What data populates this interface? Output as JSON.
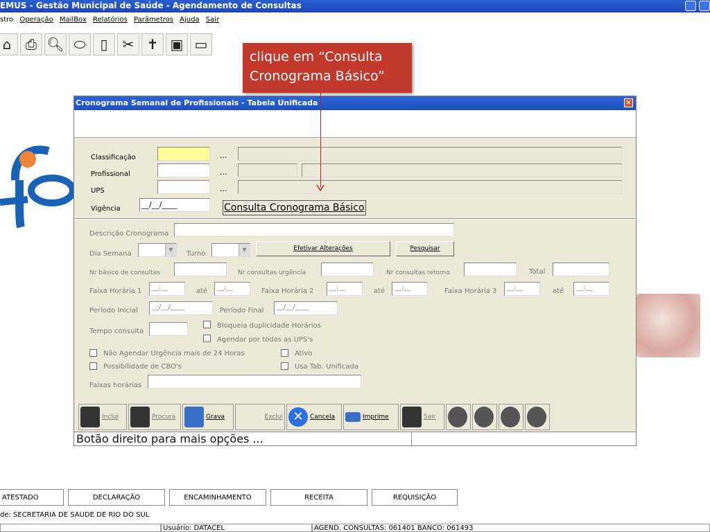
{
  "app_title": "EMUS - Gestão Municipal de Saúde - Agendamento de Consultas",
  "menu": [
    "stro",
    "Operação",
    "MailBox",
    "Relatórios",
    "Parâmetros",
    "Ajuda",
    "Sair"
  ],
  "toolbar_icons": [
    "house-icon",
    "printer-icon",
    "search-doc-icon",
    "pill-icon",
    "clipboard-icon",
    "tools-icon",
    "cross-icon",
    "medical-bag-icon",
    "ambulance-icon"
  ],
  "callout": {
    "text": "clique em “Consulta Cronograma Básico”",
    "color": "#c0392b"
  },
  "dialog": {
    "title": "Cronograma Semanal de Profissionais - Tabela Unificada",
    "labels": {
      "classificacao": "Classificação",
      "profissional": "Profissional",
      "ups": "UPS",
      "vigencia": "Vigência",
      "descricao": "Descrição Cronograma",
      "dia_semana": "Dia Semana",
      "turno": "Turno",
      "nr_basico": "Nr básico de consultas",
      "nr_urgencia": "Nr consultas urgência",
      "nr_retorno": "Nr consultas retorno",
      "total": "Total",
      "faixa1": "Faixa Horária 1",
      "faixa2": "Faixa Horária 2",
      "faixa3": "Faixa Horária 3",
      "ate": "até",
      "periodo_inicial": "Período Inicial",
      "periodo_final": "Período Final",
      "tempo_consulta": "Tempo consulta",
      "faixas_horarias": "Faixas horárias"
    },
    "dots": "...",
    "vigencia_value": "__/__/____",
    "time_mask": "__:__",
    "date_mask": "__/__/____",
    "consulta_link": "Consulta Cronograma Básico",
    "buttons": {
      "efetivar": "Efetivar Alterações",
      "pesquisar": "Pesquisar"
    },
    "checkboxes": {
      "bloqueia": "Bloqueia duplicidade Horários",
      "agendar_todas": "Agendar por todas as UPS's",
      "nao_agendar": "Não Agendar Urgência mais de 24 Horas",
      "ativo": "Ativo",
      "cbo": "Possibilidade de CBO's",
      "usa_tab": "Usa Tab. Unificada"
    },
    "footer_buttons": {
      "inclui": "Inclui",
      "procura": "Procura",
      "grava": "Grava",
      "exclui": "Exclui",
      "cancela": "Cancela",
      "imprime": "Imprime",
      "sair": "Sair"
    },
    "status": "Botão direito para mais opções ..."
  },
  "bottom_tabs": [
    "ATESTADO",
    "DECLARAÇÃO",
    "ENCAMINHAMENTO",
    "RECEITA",
    "REQUISIÇÃO"
  ],
  "unidade": "de: SECRETARIA DE SAUDE DE RIO DO SUL",
  "status_user": "Usuário: DATACEL",
  "status_agend": "AGEND. CONSULTAS: 061401 BANCO: 061493"
}
